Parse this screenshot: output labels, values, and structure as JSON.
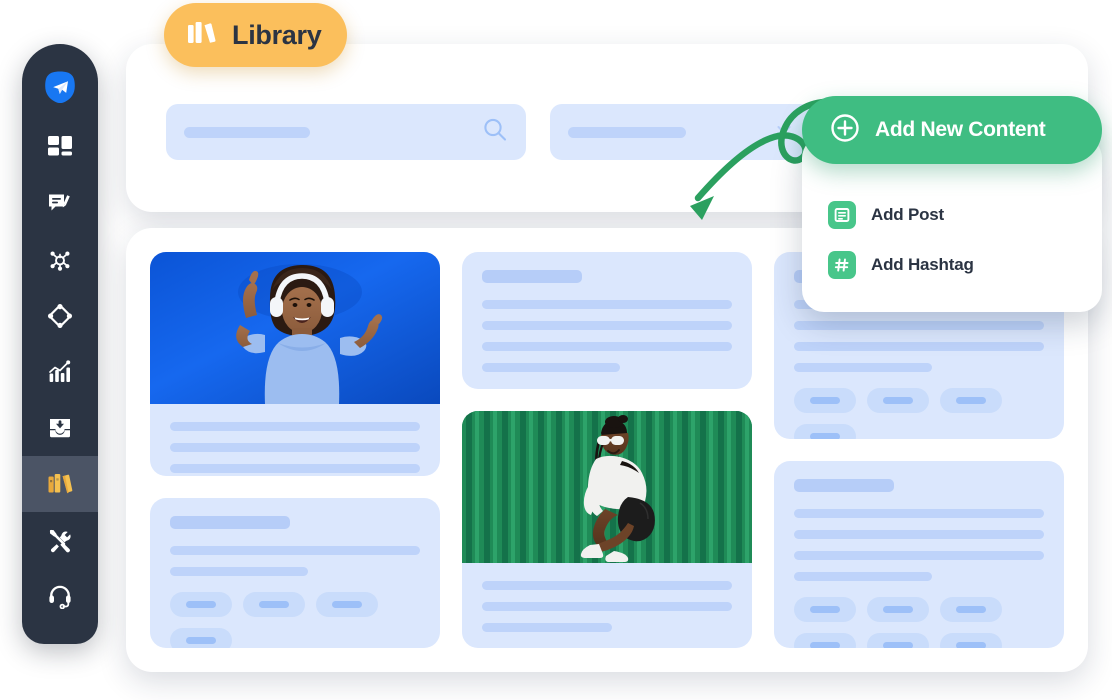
{
  "app": {
    "badge_label": "Library",
    "badge_icon": "books-icon",
    "badge_color": "#fbbf5c",
    "accent_green": "#3fbd82",
    "accent_blue": "#dbe7fd",
    "sidebar_bg": "#2b3443"
  },
  "sidebar": {
    "logo_icon": "send-plane-logo",
    "items": [
      {
        "icon": "grid-dashboard-icon",
        "name": "dashboard",
        "active": false
      },
      {
        "icon": "comment-edit-icon",
        "name": "posts",
        "active": false
      },
      {
        "icon": "network-share-icon",
        "name": "network",
        "active": false
      },
      {
        "icon": "diamond-target-icon",
        "name": "campaigns",
        "active": false
      },
      {
        "icon": "analytics-chart-icon",
        "name": "analytics",
        "active": false
      },
      {
        "icon": "inbox-download-icon",
        "name": "inbox",
        "active": false
      },
      {
        "icon": "books-icon",
        "name": "library",
        "active": true
      },
      {
        "icon": "tools-wrench-icon",
        "name": "tools",
        "active": false
      },
      {
        "icon": "headset-support-icon",
        "name": "support",
        "active": false
      }
    ]
  },
  "toolbar": {
    "search": {
      "placeholder": "",
      "value": "",
      "icon": "search-icon"
    },
    "filter": {
      "value": "",
      "icon": "chevron-down-icon"
    }
  },
  "add_content": {
    "button_label": "Add New Content",
    "button_icon": "plus-circle-icon",
    "menu": [
      {
        "label": "Add Post",
        "icon": "document-lines-icon"
      },
      {
        "label": "Add Hashtag",
        "icon": "hashtag-icon"
      }
    ]
  },
  "annotation": {
    "arrow_icon": "curved-loop-arrow",
    "arrow_color": "#2ba05f"
  },
  "library": {
    "columns": [
      {
        "cards": [
          {
            "type": "media",
            "image": "woman-headphones-blue-background",
            "lines": [
              100,
              100,
              100,
              58
            ],
            "tags": 0
          },
          {
            "type": "text",
            "title": true,
            "lines": [
              100,
              55
            ],
            "tags": 4
          }
        ]
      },
      {
        "cards": [
          {
            "type": "text",
            "title": true,
            "lines": [
              100,
              100,
              100,
              55
            ],
            "tags": 0
          },
          {
            "type": "media",
            "image": "woman-sunglasses-green-wall",
            "lines": [
              100,
              100,
              52
            ],
            "tags": 0
          }
        ]
      },
      {
        "cards": [
          {
            "type": "text",
            "title": true,
            "lines": [
              100,
              100,
              100,
              55
            ],
            "tags": 4
          },
          {
            "type": "text",
            "title": true,
            "lines": [
              100,
              100,
              100,
              55
            ],
            "tags": 6
          }
        ]
      }
    ]
  }
}
